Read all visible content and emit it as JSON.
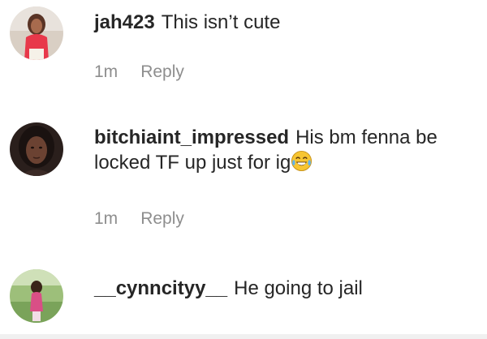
{
  "comments": [
    {
      "username": "jah423",
      "text": "This isn’t cute",
      "time": "1m",
      "reply_label": "Reply",
      "avatar": "avatar-photo-red-top"
    },
    {
      "username": "bitchiaint_impressed",
      "text": "His bm fenna be locked TF up just for ig",
      "emoji": "tears-of-joy-emoji",
      "time": "1m",
      "reply_label": "Reply",
      "avatar": "avatar-photo-dark"
    },
    {
      "username": "__cynncityy__",
      "text": "He going to jail",
      "avatar": "avatar-photo-outdoor"
    }
  ],
  "colors": {
    "text": "#262626",
    "meta": "#8e8e8e",
    "background": "#ffffff"
  }
}
